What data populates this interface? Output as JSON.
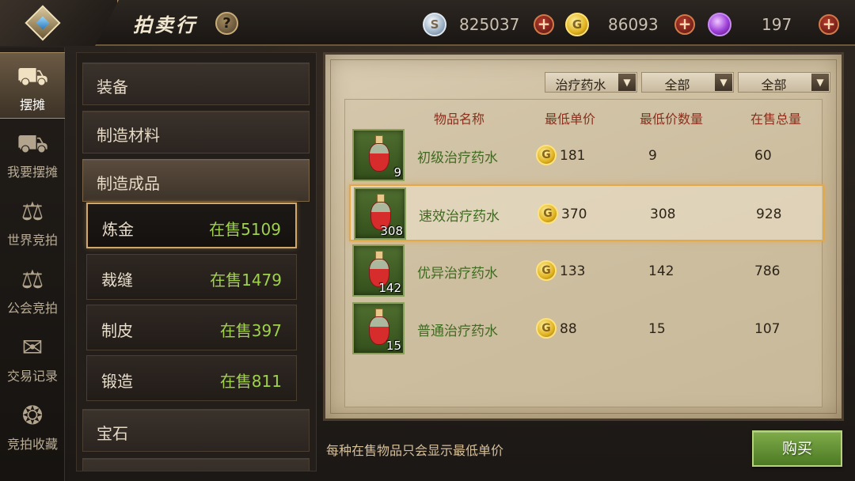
{
  "header": {
    "title": "拍卖行",
    "help_glyph": "?",
    "currencies": [
      {
        "name": "silver",
        "value": "825037"
      },
      {
        "name": "gold",
        "value": "86093"
      },
      {
        "name": "gem",
        "value": "197"
      }
    ],
    "plus_glyph": "+"
  },
  "leftnav": {
    "items": [
      {
        "label": "摆摊",
        "icon": "cart-icon",
        "active": true
      },
      {
        "label": "我要摆摊",
        "icon": "cart-add-icon",
        "active": false
      },
      {
        "label": "世界竞拍",
        "icon": "scales-icon",
        "active": false
      },
      {
        "label": "公会竞拍",
        "icon": "guild-scales-icon",
        "active": false
      },
      {
        "label": "交易记录",
        "icon": "record-icon",
        "active": false
      },
      {
        "label": "竞拍收藏",
        "icon": "favorite-icon",
        "active": false
      }
    ]
  },
  "categories": {
    "main": [
      "装备",
      "制造材料",
      "制造成品",
      "宝石"
    ],
    "subs": [
      {
        "label": "炼金",
        "count": "在售5109",
        "selected": true
      },
      {
        "label": "裁缝",
        "count": "在售1479",
        "selected": false
      },
      {
        "label": "制皮",
        "count": "在售397",
        "selected": false
      },
      {
        "label": "锻造",
        "count": "在售811",
        "selected": false
      }
    ]
  },
  "filters": {
    "type": "治疗药水",
    "level": "全部",
    "quality": "全部"
  },
  "table": {
    "headers": [
      "物品名称",
      "最低单价",
      "最低价数量",
      "在售总量"
    ],
    "rows": [
      {
        "name": "初级治疗药水",
        "count": "9",
        "price": "181",
        "min_qty": "9",
        "total": "60"
      },
      {
        "name": "速效治疗药水",
        "count": "308",
        "price": "370",
        "min_qty": "308",
        "total": "928"
      },
      {
        "name": "优异治疗药水",
        "count": "142",
        "price": "133",
        "min_qty": "142",
        "total": "786"
      },
      {
        "name": "普通治疗药水",
        "count": "15",
        "price": "88",
        "min_qty": "15",
        "total": "107"
      }
    ]
  },
  "footer": {
    "note": "每种在售物品只会显示最低单价",
    "buy_label": "购买"
  },
  "colors": {
    "accent_green": "#9fd14c",
    "header_red": "#8b2f1c",
    "selection_gold": "#e1a94a"
  }
}
